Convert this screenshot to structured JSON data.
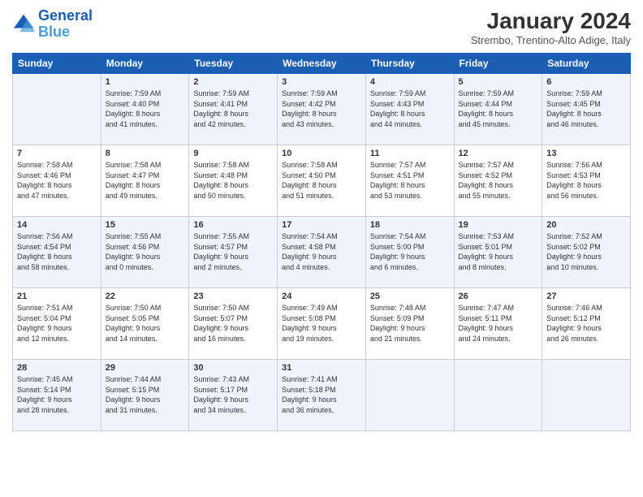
{
  "header": {
    "logo_line1": "General",
    "logo_line2": "Blue",
    "month": "January 2024",
    "location": "Strembo, Trentino-Alto Adige, Italy"
  },
  "days_of_week": [
    "Sunday",
    "Monday",
    "Tuesday",
    "Wednesday",
    "Thursday",
    "Friday",
    "Saturday"
  ],
  "weeks": [
    [
      {
        "day": "",
        "info": ""
      },
      {
        "day": "1",
        "info": "Sunrise: 7:59 AM\nSunset: 4:40 PM\nDaylight: 8 hours\nand 41 minutes."
      },
      {
        "day": "2",
        "info": "Sunrise: 7:59 AM\nSunset: 4:41 PM\nDaylight: 8 hours\nand 42 minutes."
      },
      {
        "day": "3",
        "info": "Sunrise: 7:59 AM\nSunset: 4:42 PM\nDaylight: 8 hours\nand 43 minutes."
      },
      {
        "day": "4",
        "info": "Sunrise: 7:59 AM\nSunset: 4:43 PM\nDaylight: 8 hours\nand 44 minutes."
      },
      {
        "day": "5",
        "info": "Sunrise: 7:59 AM\nSunset: 4:44 PM\nDaylight: 8 hours\nand 45 minutes."
      },
      {
        "day": "6",
        "info": "Sunrise: 7:59 AM\nSunset: 4:45 PM\nDaylight: 8 hours\nand 46 minutes."
      }
    ],
    [
      {
        "day": "7",
        "info": "Sunrise: 7:58 AM\nSunset: 4:46 PM\nDaylight: 8 hours\nand 47 minutes."
      },
      {
        "day": "8",
        "info": "Sunrise: 7:58 AM\nSunset: 4:47 PM\nDaylight: 8 hours\nand 49 minutes."
      },
      {
        "day": "9",
        "info": "Sunrise: 7:58 AM\nSunset: 4:48 PM\nDaylight: 8 hours\nand 50 minutes."
      },
      {
        "day": "10",
        "info": "Sunrise: 7:58 AM\nSunset: 4:50 PM\nDaylight: 8 hours\nand 51 minutes."
      },
      {
        "day": "11",
        "info": "Sunrise: 7:57 AM\nSunset: 4:51 PM\nDaylight: 8 hours\nand 53 minutes."
      },
      {
        "day": "12",
        "info": "Sunrise: 7:57 AM\nSunset: 4:52 PM\nDaylight: 8 hours\nand 55 minutes."
      },
      {
        "day": "13",
        "info": "Sunrise: 7:56 AM\nSunset: 4:53 PM\nDaylight: 8 hours\nand 56 minutes."
      }
    ],
    [
      {
        "day": "14",
        "info": "Sunrise: 7:56 AM\nSunset: 4:54 PM\nDaylight: 8 hours\nand 58 minutes."
      },
      {
        "day": "15",
        "info": "Sunrise: 7:55 AM\nSunset: 4:56 PM\nDaylight: 9 hours\nand 0 minutes."
      },
      {
        "day": "16",
        "info": "Sunrise: 7:55 AM\nSunset: 4:57 PM\nDaylight: 9 hours\nand 2 minutes."
      },
      {
        "day": "17",
        "info": "Sunrise: 7:54 AM\nSunset: 4:58 PM\nDaylight: 9 hours\nand 4 minutes."
      },
      {
        "day": "18",
        "info": "Sunrise: 7:54 AM\nSunset: 5:00 PM\nDaylight: 9 hours\nand 6 minutes."
      },
      {
        "day": "19",
        "info": "Sunrise: 7:53 AM\nSunset: 5:01 PM\nDaylight: 9 hours\nand 8 minutes."
      },
      {
        "day": "20",
        "info": "Sunrise: 7:52 AM\nSunset: 5:02 PM\nDaylight: 9 hours\nand 10 minutes."
      }
    ],
    [
      {
        "day": "21",
        "info": "Sunrise: 7:51 AM\nSunset: 5:04 PM\nDaylight: 9 hours\nand 12 minutes."
      },
      {
        "day": "22",
        "info": "Sunrise: 7:50 AM\nSunset: 5:05 PM\nDaylight: 9 hours\nand 14 minutes."
      },
      {
        "day": "23",
        "info": "Sunrise: 7:50 AM\nSunset: 5:07 PM\nDaylight: 9 hours\nand 16 minutes."
      },
      {
        "day": "24",
        "info": "Sunrise: 7:49 AM\nSunset: 5:08 PM\nDaylight: 9 hours\nand 19 minutes."
      },
      {
        "day": "25",
        "info": "Sunrise: 7:48 AM\nSunset: 5:09 PM\nDaylight: 9 hours\nand 21 minutes."
      },
      {
        "day": "26",
        "info": "Sunrise: 7:47 AM\nSunset: 5:11 PM\nDaylight: 9 hours\nand 24 minutes."
      },
      {
        "day": "27",
        "info": "Sunrise: 7:46 AM\nSunset: 5:12 PM\nDaylight: 9 hours\nand 26 minutes."
      }
    ],
    [
      {
        "day": "28",
        "info": "Sunrise: 7:45 AM\nSunset: 5:14 PM\nDaylight: 9 hours\nand 28 minutes."
      },
      {
        "day": "29",
        "info": "Sunrise: 7:44 AM\nSunset: 5:15 PM\nDaylight: 9 hours\nand 31 minutes."
      },
      {
        "day": "30",
        "info": "Sunrise: 7:43 AM\nSunset: 5:17 PM\nDaylight: 9 hours\nand 34 minutes."
      },
      {
        "day": "31",
        "info": "Sunrise: 7:41 AM\nSunset: 5:18 PM\nDaylight: 9 hours\nand 36 minutes."
      },
      {
        "day": "",
        "info": ""
      },
      {
        "day": "",
        "info": ""
      },
      {
        "day": "",
        "info": ""
      }
    ]
  ]
}
